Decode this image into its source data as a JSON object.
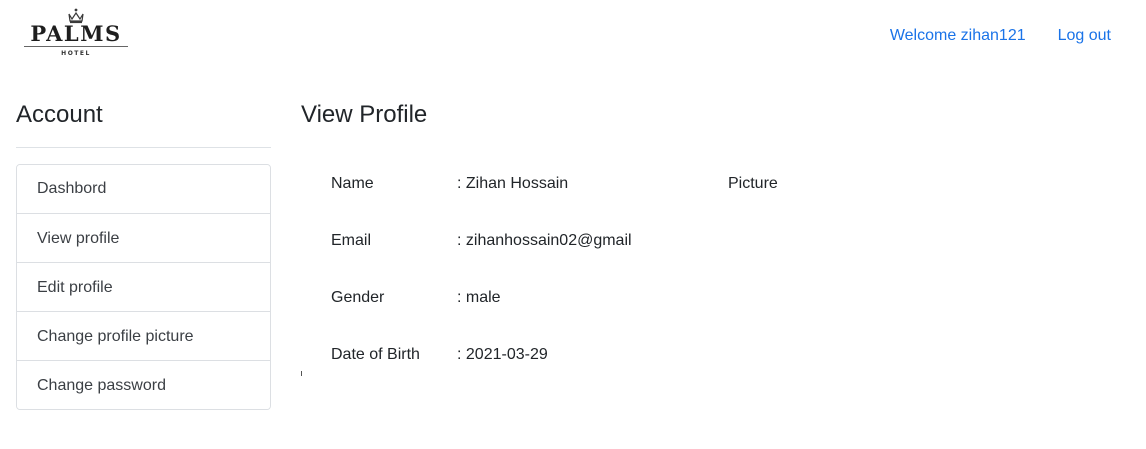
{
  "header": {
    "logo": {
      "name": "PALMS",
      "sub": "HOTEL"
    },
    "welcome": "Welcome zihan121",
    "logout": "Log out"
  },
  "sidebar": {
    "title": "Account",
    "items": [
      {
        "label": "Dashbord"
      },
      {
        "label": "View profile"
      },
      {
        "label": "Edit profile"
      },
      {
        "label": "Change profile picture"
      },
      {
        "label": "Change password"
      }
    ]
  },
  "main": {
    "title": "View Profile",
    "picture_label": "Picture",
    "fields": [
      {
        "label": "Name",
        "value": ": Zihan Hossain"
      },
      {
        "label": "Email",
        "value": ": zihanhossain02@gmail"
      },
      {
        "label": "Gender",
        "value": ": male"
      },
      {
        "label": "Date of Birth",
        "value": ": 2021-03-29"
      }
    ]
  },
  "colors": {
    "link": "#1a73e8",
    "text": "#212529",
    "border": "#dcdfe3"
  }
}
